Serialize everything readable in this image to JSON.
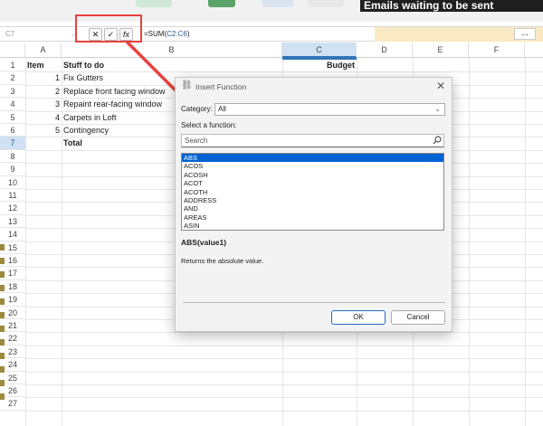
{
  "banner": {
    "text": "Emails waiting to be sent"
  },
  "formula_bar": {
    "name_box": "C7",
    "cancel_symbol": "✕",
    "accept_symbol": "✓",
    "fx_symbol": "fx",
    "formula_prefix": "=SUM(",
    "formula_ref": "C2:C6",
    "formula_suffix": ")",
    "more_symbol": "..."
  },
  "columns": [
    "A",
    "B",
    "C",
    "D",
    "E",
    "F"
  ],
  "rows": [
    "1",
    "2",
    "3",
    "4",
    "5",
    "6",
    "7",
    "8",
    "9",
    "10",
    "11",
    "12",
    "13",
    "14",
    "15",
    "16",
    "17",
    "18",
    "19",
    "20",
    "21",
    "22",
    "23",
    "24",
    "25",
    "26",
    "27"
  ],
  "cells": {
    "A1": "Item",
    "B1": "Stuff to do",
    "C1": "Budget",
    "A2": "1",
    "B2": "Fix Gutters",
    "A3": "2",
    "B3": "Replace front facing window",
    "A4": "3",
    "B4": "Repaint rear-facing window",
    "A5": "4",
    "B5": "Carpets in Loft",
    "A6": "5",
    "B6": "Contingency",
    "B7": "Total"
  },
  "dialog": {
    "title": "Insert Function",
    "close_symbol": "✕",
    "category_label": "Category:",
    "category_value": "All",
    "select_label": "Select a function:",
    "search_placeholder": "Search",
    "functions": [
      "ABS",
      "ACOS",
      "ACOSH",
      "ACOT",
      "ACOTH",
      "ADDRESS",
      "AND",
      "AREAS",
      "ASIN"
    ],
    "selected_index": 0,
    "syntax": "ABS(value1)",
    "description": "Returns the absolute value.",
    "ok_label": "OK",
    "cancel_label": "Cancel"
  },
  "colors": {
    "accent": "#0063d1",
    "highlight_box": "#e8413f",
    "selected_header": "#cfe1f2"
  },
  "icons": {
    "search": "search-icon",
    "dialog_logo": "function-wizard-icon",
    "dropdown": "chevron-down-icon"
  }
}
